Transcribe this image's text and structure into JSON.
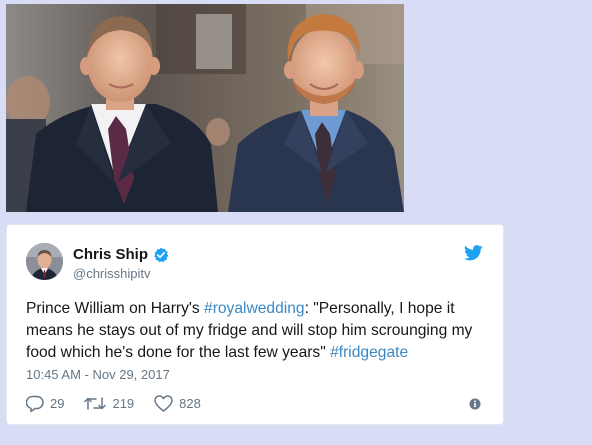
{
  "photo": {
    "description_icon": "photo-two-men-in-suits"
  },
  "tweet": {
    "user_name": "Chris Ship",
    "handle": "@chrisshipitv",
    "verified_icon": "verified-badge-icon",
    "platform_icon": "twitter-bird-icon",
    "text_segments": [
      {
        "type": "text",
        "value": "Prince William on Harry's "
      },
      {
        "type": "hashtag",
        "value": "#royalwedding"
      },
      {
        "type": "text",
        "value": ": \"Personally, I hope it means he stays out of my fridge and will stop him scrounging my food which he's done for the last few years\" "
      },
      {
        "type": "hashtag",
        "value": "#fridgegate"
      }
    ],
    "timestamp": "10:45 AM - Nov 29, 2017",
    "replies": "29",
    "retweets": "219",
    "likes": "828",
    "info_icon": "info-icon"
  },
  "colors": {
    "page_background": "#d8dcf4",
    "hashtag": "#3b88c3",
    "twitter_blue": "#1da1f2",
    "muted_text": "#657786",
    "primary_text": "#14171a"
  }
}
